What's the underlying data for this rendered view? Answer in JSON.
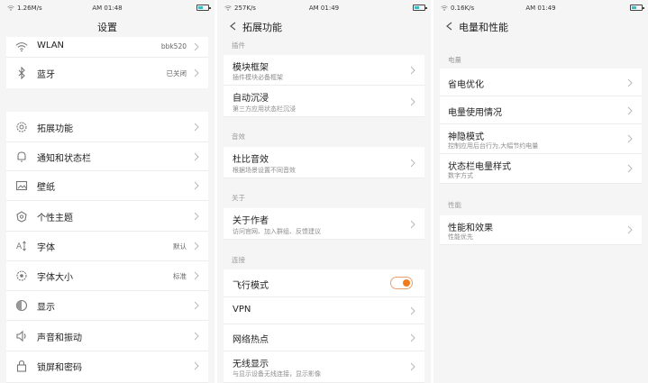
{
  "screen1": {
    "status": {
      "speed": "1.26M/s",
      "time": "AM 01:48"
    },
    "title": "设置",
    "items": [
      {
        "label": "WLAN",
        "value": "bbk520"
      },
      {
        "label": "蓝牙",
        "value": "已关闭"
      },
      {
        "label": "拓展功能"
      },
      {
        "label": "通知和状态栏"
      },
      {
        "label": "壁纸"
      },
      {
        "label": "个性主题"
      },
      {
        "label": "字体",
        "value": "默认"
      },
      {
        "label": "字体大小",
        "value": "标准"
      },
      {
        "label": "显示"
      },
      {
        "label": "声音和振动"
      },
      {
        "label": "锁屏和密码"
      }
    ]
  },
  "screen2": {
    "status": {
      "speed": "257K/s",
      "time": "AM 01:49"
    },
    "title": "拓展功能",
    "sections": {
      "plugin": "插件",
      "audio": "音效",
      "about": "关于",
      "connect": "连接"
    },
    "items": [
      {
        "label": "模块框架",
        "sub": "插件模块必备框架"
      },
      {
        "label": "自动沉浸",
        "sub": "第三方应用状态栏沉浸"
      },
      {
        "label": "杜比音效",
        "sub": "根据场景设置不同音效"
      },
      {
        "label": "关于作者",
        "sub": "访问官网、加入群组、反馈建议"
      },
      {
        "label": "飞行模式"
      },
      {
        "label": "VPN"
      },
      {
        "label": "网络热点"
      },
      {
        "label": "无线显示",
        "sub": "与显示设备无线连接，显示影像"
      }
    ]
  },
  "screen3": {
    "status": {
      "speed": "0.16K/s",
      "time": "AM 01:49"
    },
    "title": "电量和性能",
    "sections": {
      "battery": "电量",
      "performance": "性能"
    },
    "items": [
      {
        "label": "省电优化"
      },
      {
        "label": "电量使用情况"
      },
      {
        "label": "神隐模式",
        "sub": "控制应用后台行为,大幅节约电量"
      },
      {
        "label": "状态栏电量样式",
        "sub": "数字方式"
      },
      {
        "label": "性能和效果",
        "sub": "性能优先"
      }
    ]
  },
  "colors": {
    "accent": "#f07a1c",
    "background": "#f5f5f5",
    "row": "#ffffff"
  },
  "toggles": {
    "airplane_mode_on": true
  }
}
